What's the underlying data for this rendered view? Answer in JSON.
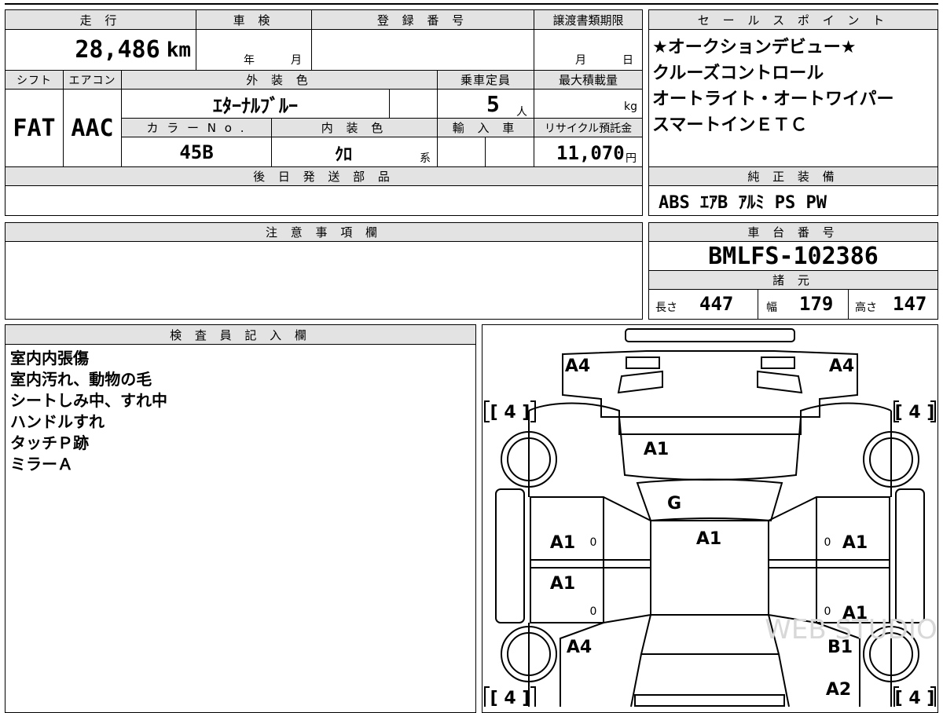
{
  "mileage": {
    "header": "走 行",
    "value": "28,486",
    "unit": "km"
  },
  "inspection": {
    "header": "車 検",
    "year": "年",
    "month": "月"
  },
  "registration": {
    "header": "登 録 番 号"
  },
  "transfer": {
    "header": "譲渡書類期限",
    "month": "月",
    "day": "日"
  },
  "shift": {
    "header": "シフト",
    "value": "FAT"
  },
  "aircon": {
    "header": "エアコン",
    "value": "AAC"
  },
  "exterior": {
    "header": "外 装 色",
    "value": "ｴﾀｰﾅﾙﾌﾞﾙｰ"
  },
  "capacity": {
    "header": "乗車定員",
    "value": "5",
    "unit": "人"
  },
  "max_load": {
    "header": "最大積載量",
    "unit": "kg"
  },
  "color_no": {
    "header": "カ ラ ー N o .",
    "value": "45B"
  },
  "interior": {
    "header": "内 装 色",
    "value": "ｸﾛ",
    "suffix": "系"
  },
  "import": {
    "header": "輸 入 車"
  },
  "recycle": {
    "header": "リサイクル預託金",
    "value": "11,070",
    "unit": "円"
  },
  "later_parts": {
    "header": "後 日 発 送 部 品"
  },
  "sales_points": {
    "header": "セ ー ル ス ポ イ ン ト",
    "items": [
      "★オークションデビュー★",
      "クルーズコントロール",
      "オートライト・オートワイパー",
      "スマートインＥＴＣ"
    ]
  },
  "equipment": {
    "header": "純 正 装 備",
    "value": "ABS ｴｱB ｱﾙﾐ PS PW"
  },
  "notes": {
    "header": "注 意 事 項 欄"
  },
  "chassis": {
    "header": "車 台 番 号",
    "value": "BMLFS-102386"
  },
  "specs": {
    "header": "諸 元",
    "length_label": "長さ",
    "length": "447",
    "width_label": "幅",
    "width": "179",
    "height_label": "高さ",
    "height": "147"
  },
  "inspector": {
    "header": "検 査 員 記 入 欄",
    "lines": [
      "室内内張傷",
      "室内汚れ、動物の毛",
      "シートしみ中、すれ中",
      "ハンドルすれ",
      "タッチＰ跡",
      "ミラーＡ"
    ]
  },
  "diagram": {
    "tire_marks": [
      "[ 4 ]",
      "[ 4 ]",
      "[ 4 ]",
      "[ 4 ]"
    ],
    "marks": {
      "front_left": "A4",
      "front_right": "A4",
      "hood": "A1",
      "windshield": "G",
      "roof": "A1",
      "left_front_door": "A1",
      "left_rear_door": "A1",
      "right_front_door": "A1",
      "right_rear_door": "A1",
      "left_rear_fender": "A4",
      "right_rear_fender": "B1",
      "right_rear": "A2"
    },
    "small": "0",
    "watermark": "WEB STUDIO"
  }
}
